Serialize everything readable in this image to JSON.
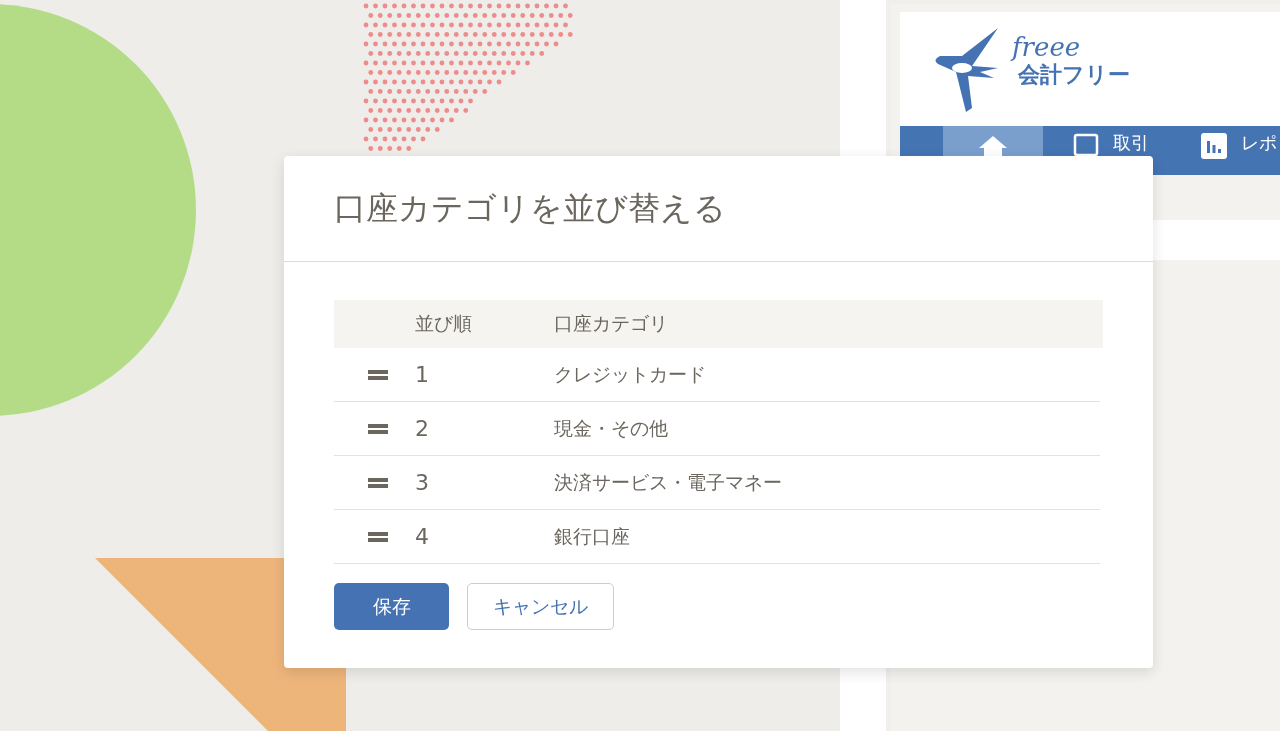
{
  "app": {
    "logo": {
      "script": "freee",
      "name": "会計フリー"
    },
    "nav": [
      {
        "kind": "home",
        "selected": true
      },
      {
        "kind": "deals",
        "label": "取引",
        "selected": false
      },
      {
        "kind": "reports",
        "label": "レポ",
        "selected": false
      }
    ]
  },
  "dialog": {
    "title": "口座カテゴリを並び替える",
    "columns": [
      "並び順",
      "口座カテゴリ"
    ],
    "rows": [
      {
        "order": "1",
        "category": "クレジットカード"
      },
      {
        "order": "2",
        "category": "現金・その他"
      },
      {
        "order": "3",
        "category": "決済サービス・電子マネー"
      },
      {
        "order": "4",
        "category": "銀行口座"
      }
    ],
    "buttons": [
      {
        "kind": "primary",
        "label": "保存"
      },
      {
        "kind": "secondary",
        "label": "キャンセル"
      }
    ]
  }
}
